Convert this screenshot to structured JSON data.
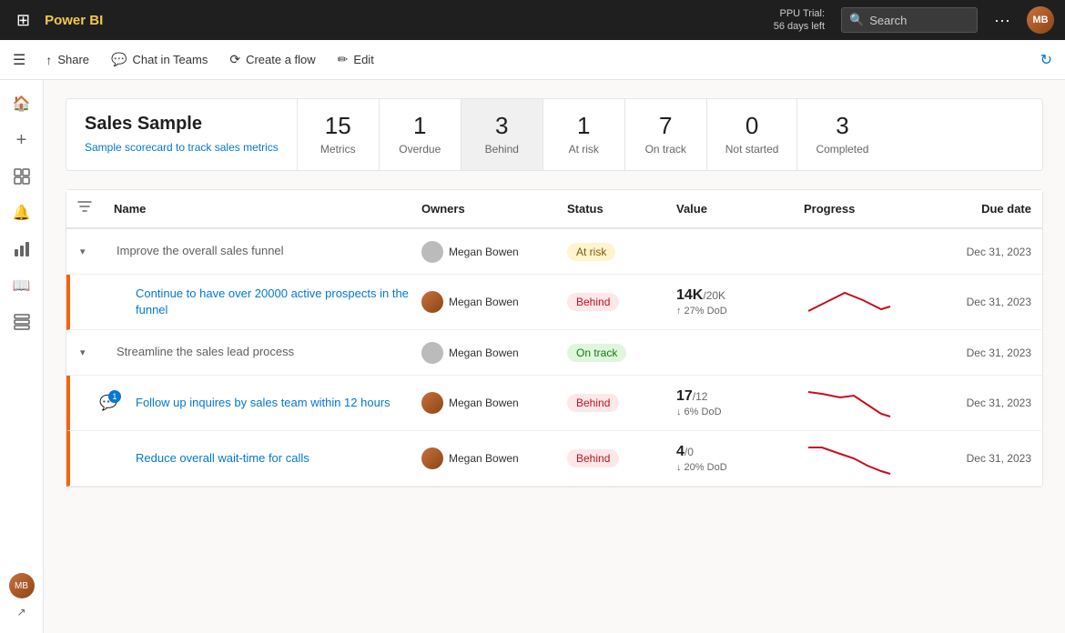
{
  "topbar": {
    "logo": "Power BI",
    "trial_line1": "PPU Trial:",
    "trial_line2": "56 days left",
    "search_placeholder": "Search",
    "more_label": "···"
  },
  "toolbar": {
    "hamburger_label": "☰",
    "share_label": "Share",
    "chat_label": "Chat in Teams",
    "flow_label": "Create a flow",
    "edit_label": "Edit"
  },
  "sidebar": {
    "items": [
      {
        "icon": "⊞",
        "name": "home"
      },
      {
        "icon": "+",
        "name": "create"
      },
      {
        "icon": "⬚",
        "name": "browse"
      },
      {
        "icon": "🔔",
        "name": "notifications"
      },
      {
        "icon": "⊟",
        "name": "apps"
      },
      {
        "icon": "📖",
        "name": "learn"
      },
      {
        "icon": "🖥",
        "name": "workspaces"
      }
    ]
  },
  "scorecard": {
    "title": "Sales Sample",
    "description": "Sample scorecard to track sales metrics",
    "metrics": [
      {
        "number": "15",
        "label": "Metrics"
      },
      {
        "number": "1",
        "label": "Overdue"
      },
      {
        "number": "3",
        "label": "Behind",
        "active": true
      },
      {
        "number": "1",
        "label": "At risk"
      },
      {
        "number": "7",
        "label": "On track"
      },
      {
        "number": "0",
        "label": "Not started"
      },
      {
        "number": "3",
        "label": "Completed"
      }
    ]
  },
  "table": {
    "columns": [
      "",
      "Name",
      "Owners",
      "Status",
      "Value",
      "Progress",
      "Due date"
    ],
    "rows": [
      {
        "indent": false,
        "expand": true,
        "name": "Improve the overall sales funnel",
        "owner": "Megan Bowen",
        "owner_type": "gray",
        "status": "At risk",
        "status_type": "atrisk",
        "value": "",
        "value_sub": "",
        "change": "",
        "has_chart": false,
        "duedate": "Dec 31, 2023",
        "orange_border": false,
        "notif": false
      },
      {
        "indent": true,
        "expand": false,
        "name": "Continue to have over 20000 active prospects in the funnel",
        "owner": "Megan Bowen",
        "owner_type": "normal",
        "status": "Behind",
        "status_type": "behind",
        "value": "14K",
        "value_sub": "/20K",
        "change": "↑ 27% DoD",
        "has_chart": true,
        "chart_type": "up_then_down",
        "duedate": "Dec 31, 2023",
        "orange_border": true,
        "notif": false
      },
      {
        "indent": false,
        "expand": true,
        "name": "Streamline the sales lead process",
        "owner": "Megan Bowen",
        "owner_type": "gray",
        "status": "On track",
        "status_type": "ontrack",
        "value": "",
        "value_sub": "",
        "change": "",
        "has_chart": false,
        "duedate": "Dec 31, 2023",
        "orange_border": false,
        "notif": false
      },
      {
        "indent": true,
        "expand": false,
        "name": "Follow up inquires by sales team within 12 hours",
        "owner": "Megan Bowen",
        "owner_type": "normal",
        "status": "Behind",
        "status_type": "behind",
        "value": "17",
        "value_sub": "/12",
        "change": "↓ 6% DoD",
        "has_chart": true,
        "chart_type": "down",
        "duedate": "Dec 31, 2023",
        "orange_border": true,
        "notif": true
      },
      {
        "indent": true,
        "expand": false,
        "name": "Reduce overall wait-time for calls",
        "owner": "Megan Bowen",
        "owner_type": "normal",
        "status": "Behind",
        "status_type": "behind",
        "value": "4",
        "value_sub": "/0",
        "change": "↓ 20% DoD",
        "has_chart": true,
        "chart_type": "down_steep",
        "duedate": "Dec 31, 2023",
        "orange_border": true,
        "notif": false
      }
    ]
  }
}
